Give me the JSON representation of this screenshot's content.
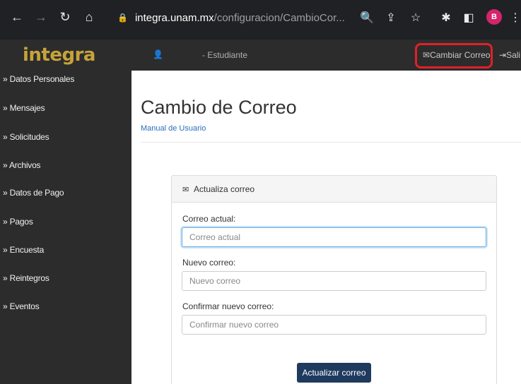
{
  "browser": {
    "url_domain": "integra.unam.mx",
    "url_path": "/configuracion/CambioCor...",
    "profile_initial": "B"
  },
  "header": {
    "logo": "integra",
    "user_role": "- Estudiante",
    "change_email_link": "Cambiar Correo",
    "logout_link": "Sali"
  },
  "sidebar": {
    "items": [
      {
        "label": "» Datos Personales"
      },
      {
        "label": "» Mensajes"
      },
      {
        "label": "» Solicitudes"
      },
      {
        "label": "» Archivos"
      },
      {
        "label": "» Datos de Pago"
      },
      {
        "label": "» Pagos"
      },
      {
        "label": "» Encuesta"
      },
      {
        "label": "» Reintegros"
      },
      {
        "label": "» Eventos"
      }
    ]
  },
  "main": {
    "title": "Cambio de Correo",
    "manual_link": "Manual de Usuario",
    "panel_title": "Actualiza correo",
    "fields": [
      {
        "label": "Correo actual:",
        "placeholder": "Correo actual"
      },
      {
        "label": "Nuevo correo:",
        "placeholder": "Nuevo correo"
      },
      {
        "label": "Confirmar nuevo correo:",
        "placeholder": "Confirmar nuevo correo"
      }
    ],
    "submit_label": "Actualizar correo"
  }
}
